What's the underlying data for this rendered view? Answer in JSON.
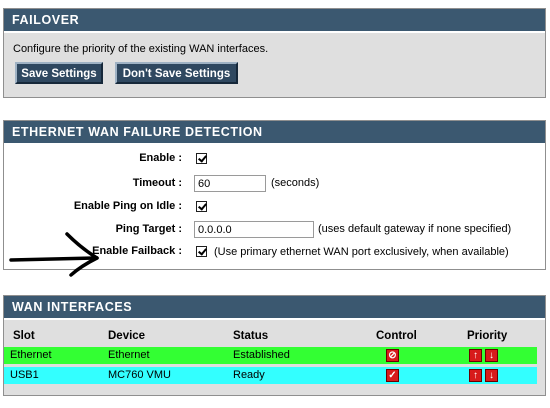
{
  "failover": {
    "title": "FAILOVER",
    "description": "Configure the priority of the existing WAN interfaces.",
    "save_label": "Save Settings",
    "dont_save_label": "Don't Save Settings"
  },
  "detection": {
    "title": "ETHERNET WAN FAILURE DETECTION",
    "enable_label": "Enable :",
    "enable_checked": true,
    "timeout_label": "Timeout :",
    "timeout_value": "60",
    "timeout_unit": "(seconds)",
    "ping_idle_label": "Enable Ping on Idle :",
    "ping_idle_checked": true,
    "ping_target_label": "Ping Target :",
    "ping_target_value": "0.0.0.0",
    "ping_target_note": "(uses default gateway if none specified)",
    "failback_label": "Enable Failback :",
    "failback_checked": true,
    "failback_note": "(Use primary ethernet WAN port exclusively, when available)"
  },
  "wan": {
    "title": "WAN INTERFACES",
    "columns": [
      "Slot",
      "Device",
      "Status",
      "Control",
      "Priority"
    ],
    "rows": [
      {
        "slot": "Ethernet",
        "device": "Ethernet",
        "status": "Established",
        "control_icon": "stop-icon",
        "row_color": "#33ff33"
      },
      {
        "slot": "USB1",
        "device": "MC760 VMU",
        "status": "Ready",
        "control_icon": "check-icon",
        "row_color": "#33ffff"
      }
    ],
    "priority_icons": [
      "arrow-up-icon",
      "arrow-down-icon"
    ]
  },
  "colors": {
    "header_bg": "#3b5870",
    "panel_bg": "#dfdfdf",
    "button_bg": "#2f4860",
    "icon_red": "#d71b1b"
  }
}
